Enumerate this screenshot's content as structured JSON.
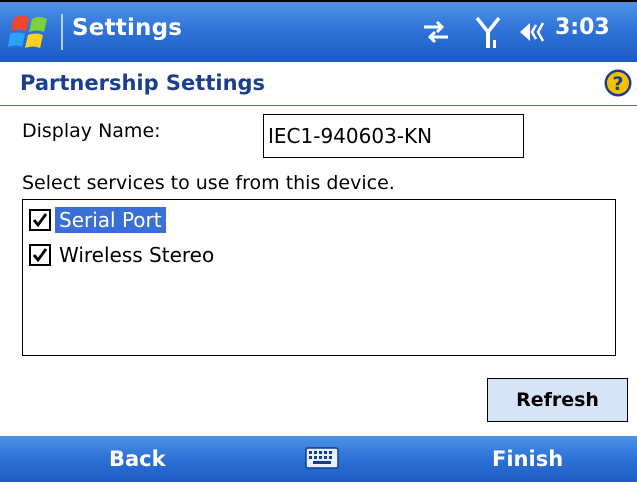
{
  "titlebar": {
    "app_title": "Settings",
    "time": "3:03",
    "icons": [
      "windows-start-icon",
      "sync-icon",
      "signal-antenna-icon",
      "speaker-volume-icon"
    ]
  },
  "header": {
    "page_title": "Partnership Settings",
    "help_icon": "help-question-icon"
  },
  "form": {
    "display_name_label": "Display Name:",
    "display_name_value": "IEC1-940603-KN",
    "services_prompt": "Select services to use from this device."
  },
  "services": [
    {
      "label": "Serial Port",
      "checked": true,
      "selected": true
    },
    {
      "label": "Wireless Stereo",
      "checked": true,
      "selected": false
    }
  ],
  "buttons": {
    "refresh": "Refresh"
  },
  "softkeys": {
    "left": "Back",
    "right": "Finish",
    "center_icon": "keyboard-icon"
  },
  "colors": {
    "bar_blue": "#2f74d8",
    "title_text": "#1b3f8c",
    "selection": "#3a6fd8",
    "button_bg": "#d7e4f5"
  }
}
